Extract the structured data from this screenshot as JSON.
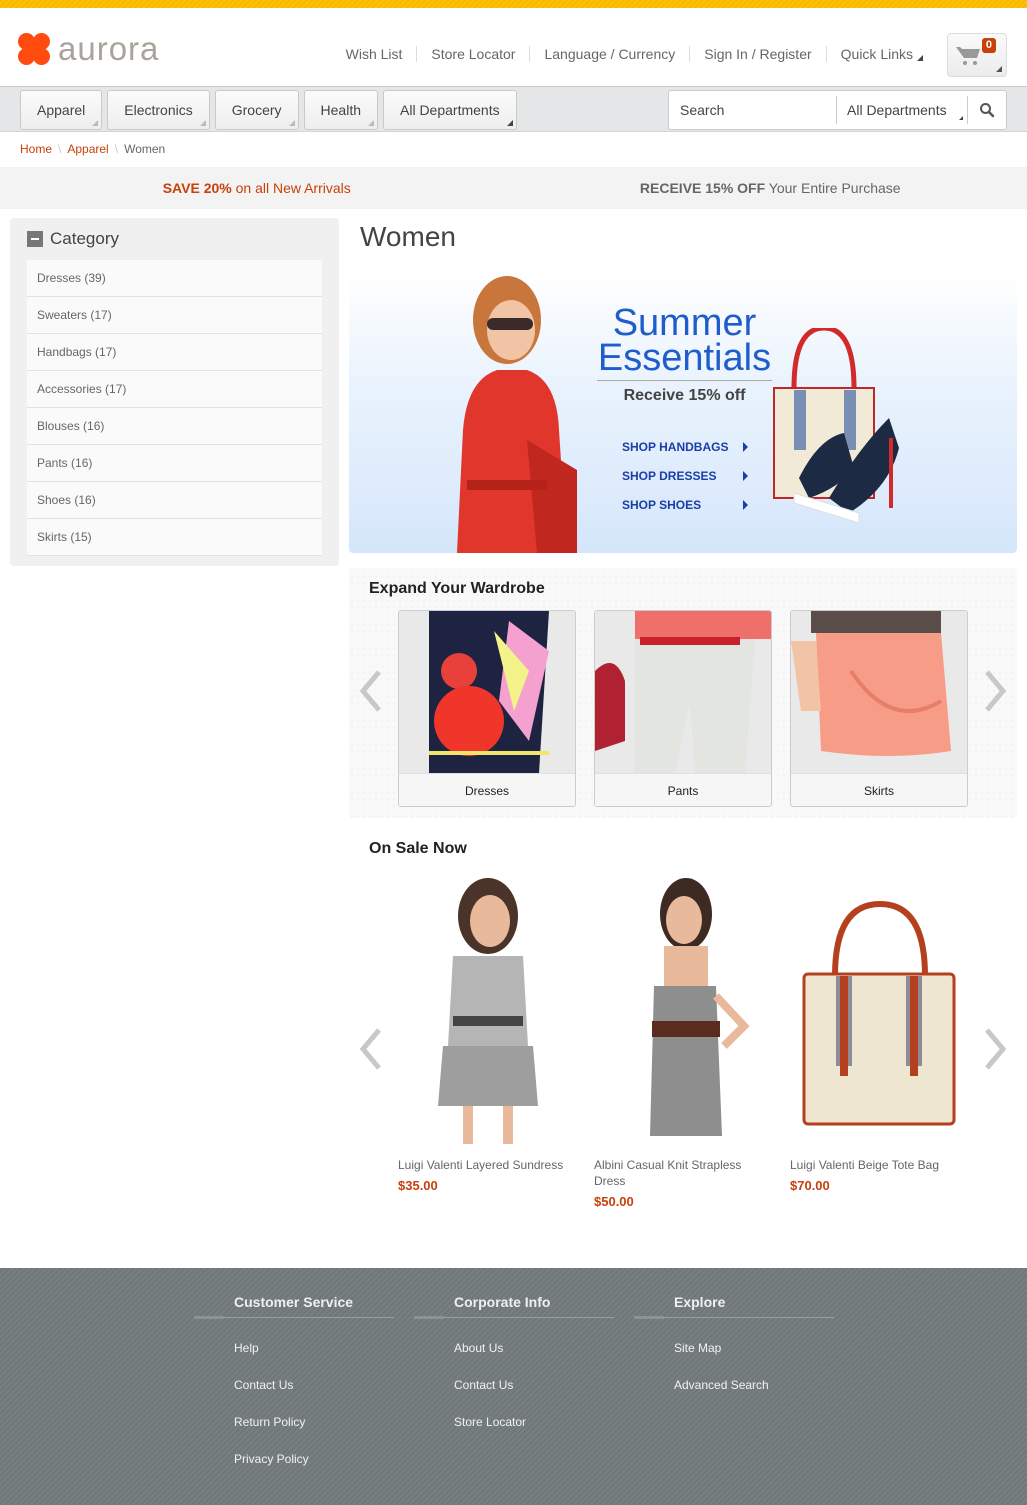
{
  "brand": {
    "name": "aurora",
    "accent": "#ff4b10",
    "price_color": "#c8400a"
  },
  "header": {
    "links": [
      "Wish List",
      "Store Locator",
      "Language / Currency",
      "Sign In / Register",
      "Quick Links"
    ],
    "cart": {
      "icon": "shopping-cart-icon",
      "count": "0"
    }
  },
  "nav": {
    "departments": [
      "Apparel",
      "Electronics",
      "Grocery",
      "Health",
      "All Departments"
    ],
    "search": {
      "placeholder": "Search",
      "department": "All Departments",
      "button_icon": "search-icon"
    }
  },
  "breadcrumb": {
    "items": [
      "Home",
      "Apparel"
    ],
    "current": "Women"
  },
  "promos": {
    "left": {
      "bold": "SAVE 20%",
      "text": " on all New Arrivals"
    },
    "right": {
      "bold": "RECEIVE 15% OFF",
      "text": " Your Entire Purchase"
    }
  },
  "sidebar": {
    "title": "Category",
    "categories": [
      "Dresses (39)",
      "Sweaters (17)",
      "Handbags (17)",
      "Accessories (17)",
      "Blouses (16)",
      "Pants (16)",
      "Shoes (16)",
      "Skirts (15)"
    ]
  },
  "main": {
    "title": "Women",
    "hero": {
      "title_line1": "Summer",
      "title_line2": "Essentials",
      "subtitle": "Receive 15% off",
      "links": [
        "SHOP HANDBAGS",
        "SHOP DRESSES",
        "SHOP SHOES"
      ]
    },
    "wardrobe": {
      "title": "Expand Your Wardrobe",
      "tiles": [
        "Dresses",
        "Pants",
        "Skirts"
      ]
    },
    "sale": {
      "title": "On Sale Now",
      "products": [
        {
          "name": "Luigi Valenti Layered Sundress",
          "price": "$35.00"
        },
        {
          "name": "Albini Casual Knit Strapless Dress",
          "price": "$50.00"
        },
        {
          "name": "Luigi Valenti Beige Tote Bag",
          "price": "$70.00"
        }
      ]
    }
  },
  "footer": {
    "columns": [
      {
        "title": "Customer Service",
        "links": [
          "Help",
          "Contact Us",
          "Return Policy",
          "Privacy Policy"
        ]
      },
      {
        "title": "Corporate Info",
        "links": [
          "About Us",
          "Contact Us",
          "Store Locator"
        ]
      },
      {
        "title": "Explore",
        "links": [
          "Site Map",
          "Advanced Search"
        ]
      }
    ]
  }
}
